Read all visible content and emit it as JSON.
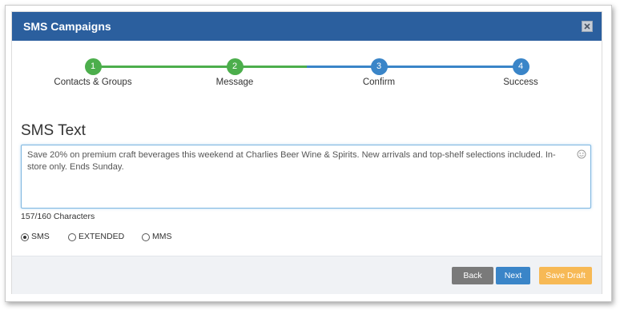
{
  "window": {
    "title": "SMS Campaigns",
    "close_icon": "close-icon"
  },
  "stepper": {
    "completed_color": "#4cae4c",
    "pending_color": "#3a85c8",
    "steps": [
      {
        "number": "1",
        "label": "Contacts & Groups",
        "status": "complete"
      },
      {
        "number": "2",
        "label": "Message",
        "status": "complete"
      },
      {
        "number": "3",
        "label": "Confirm",
        "status": "pending"
      },
      {
        "number": "4",
        "label": "Success",
        "status": "pending"
      }
    ]
  },
  "editor": {
    "heading": "SMS Text",
    "message": "Save 20% on premium craft beverages this weekend at Charlies Beer Wine & Spirits. New arrivals and top-shelf selections included. In-store only. Ends Sunday.",
    "emoji_icon": "smiley-icon",
    "char_count": "157/160 Characters"
  },
  "message_type": {
    "selected": "SMS",
    "options": [
      {
        "label": "SMS",
        "checked": true
      },
      {
        "label": "EXTENDED",
        "checked": false
      },
      {
        "label": "MMS",
        "checked": false
      }
    ]
  },
  "footer": {
    "back_label": "Back",
    "next_label": "Next",
    "save_draft_label": "Save Draft"
  },
  "colors": {
    "header": "#2b5f9e",
    "back_button": "#7a7a7a",
    "next_button": "#3a85c8",
    "save_draft_button": "#f7b955"
  }
}
